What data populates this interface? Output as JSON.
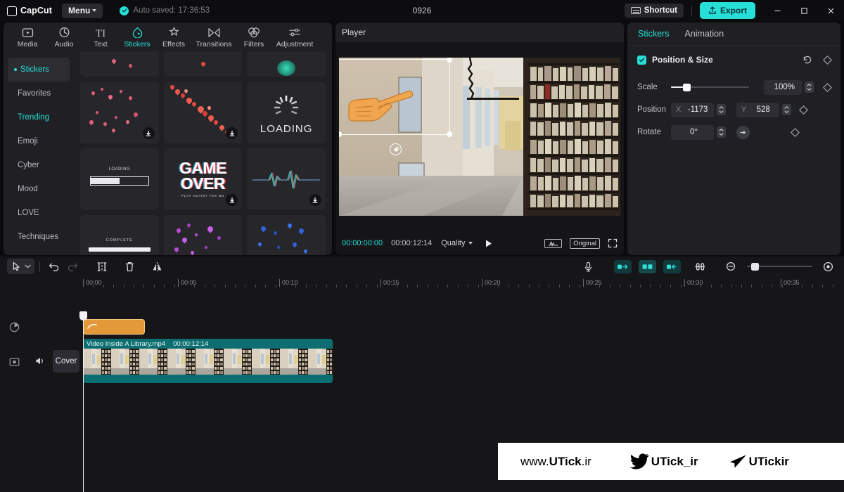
{
  "titlebar": {
    "brand": "CapCut",
    "menu_label": "Menu",
    "autosave_text": "Auto saved: 17:36:53",
    "project_title": "0926",
    "shortcut_label": "Shortcut",
    "export_label": "Export",
    "minimize_glyph": "–",
    "maximize_glyph": "□",
    "close_glyph": "✕"
  },
  "category_tabs": [
    {
      "label": "Media",
      "icon": "media-icon"
    },
    {
      "label": "Audio",
      "icon": "audio-icon"
    },
    {
      "label": "Text",
      "icon": "text-icon"
    },
    {
      "label": "Stickers",
      "icon": "stickers-icon"
    },
    {
      "label": "Effects",
      "icon": "effects-icon"
    },
    {
      "label": "Transitions",
      "icon": "transitions-icon"
    },
    {
      "label": "Filters",
      "icon": "filters-icon"
    },
    {
      "label": "Adjustment",
      "icon": "adjustment-icon"
    }
  ],
  "active_category": "Stickers",
  "sidebar": {
    "items": [
      {
        "label": "Stickers",
        "state": "selected"
      },
      {
        "label": "Favorites",
        "state": "normal"
      },
      {
        "label": "Trending",
        "state": "highlight"
      },
      {
        "label": "Emoji",
        "state": "normal"
      },
      {
        "label": "Cyber",
        "state": "normal"
      },
      {
        "label": "Mood",
        "state": "normal"
      },
      {
        "label": "LOVE",
        "state": "normal"
      },
      {
        "label": "Techniques",
        "state": "normal"
      }
    ]
  },
  "sticker_grid": {
    "items": [
      {
        "name": "pink-hearts-confetti",
        "kind": "confetti",
        "color": "#e0607a",
        "downloadable": true
      },
      {
        "name": "red-hearts-diagonal",
        "kind": "confetti-diagonal",
        "color": "#e8483f",
        "downloadable": true
      },
      {
        "name": "loading-spinner",
        "kind": "loading",
        "caption": "LOADING",
        "downloadable": false
      },
      {
        "name": "loading-bar",
        "kind": "bar",
        "caption": "LOADING",
        "downloadable": false
      },
      {
        "name": "game-over",
        "kind": "gameover",
        "line1": "GAME",
        "line2": "OVER",
        "sub": "PLAY AGAIN?  YES   NO",
        "downloadable": true
      },
      {
        "name": "waveform-glitch",
        "kind": "wave",
        "downloadable": true
      },
      {
        "name": "complete-bar",
        "kind": "complete",
        "caption": "COMPLETE",
        "downloadable": true
      },
      {
        "name": "purple-hearts",
        "kind": "confetti",
        "color": "#b84ddb",
        "downloadable": true
      },
      {
        "name": "blue-hearts",
        "kind": "confetti",
        "color": "#2f63d8",
        "downloadable": true
      }
    ]
  },
  "player": {
    "title": "Player",
    "current_time": "00:00:00:00",
    "total_time": "00:00:12:14",
    "quality_label": "Quality",
    "play_icon": "play-icon",
    "waveform_icon": "audio-waveform-icon",
    "ratio_label": "Original",
    "fullscreen_icon": "fullscreen-icon",
    "sticker_overlay": "pointing-hand-sticker"
  },
  "right_panel": {
    "tabs": [
      {
        "label": "Stickers",
        "active": true
      },
      {
        "label": "Animation",
        "active": false
      }
    ],
    "section": {
      "title": "Position & Size",
      "checked": true,
      "reset_icon": "reset-icon",
      "keyframe_icon": "keyframe-diamond-icon"
    },
    "rows": [
      {
        "label": "Scale",
        "value": "100%",
        "slider_percent": 18
      },
      {
        "label": "Position",
        "x_axis": "X",
        "x_value": "-1173",
        "y_axis": "Y",
        "y_value": "528"
      },
      {
        "label": "Rotate",
        "value": "0°"
      }
    ]
  },
  "timeline": {
    "toolbar": {
      "select_icon": "cursor-select-icon",
      "undo_icon": "undo-icon",
      "redo_icon": "redo-icon",
      "split_icon": "split-icon",
      "delete_icon": "delete-icon",
      "mirror_icon": "mirror-icon",
      "mic_icon": "microphone-icon",
      "clip_left_icon": "clip-edit-left-icon",
      "clip_center_icon": "clip-edit-center-icon",
      "clip_right_icon": "clip-edit-right-icon",
      "link_icon": "link-clips-icon",
      "zoom_out_icon": "zoom-out-icon",
      "zoom_fit_icon": "zoom-fit-icon",
      "zoom_percent": 8
    },
    "ruler_labels": [
      "00:00",
      "00:05",
      "00:10",
      "00:15",
      "00:20",
      "00:25",
      "00:30",
      "00:35"
    ],
    "tracks": {
      "sticker_track_icon": "sticker-track-icon",
      "video_track_icon": "video-track-icon",
      "cover_label": "Cover",
      "mute_icon": "volume-icon"
    },
    "video_clip": {
      "name": "Video Inside A Library.mp4",
      "duration": "00:00:12:14"
    }
  },
  "watermark": {
    "site": "www.",
    "site_bold": "UTick",
    "site_tail": ".ir",
    "twitter_handle": "UTick_ir",
    "telegram_handle": "UTickir",
    "twitter_icon": "twitter-bird-icon",
    "telegram_icon": "telegram-plane-icon"
  },
  "colors": {
    "accent": "#27dfd6",
    "clip_teal": "#0d6e72",
    "sticker_orange": "#e3983a"
  }
}
